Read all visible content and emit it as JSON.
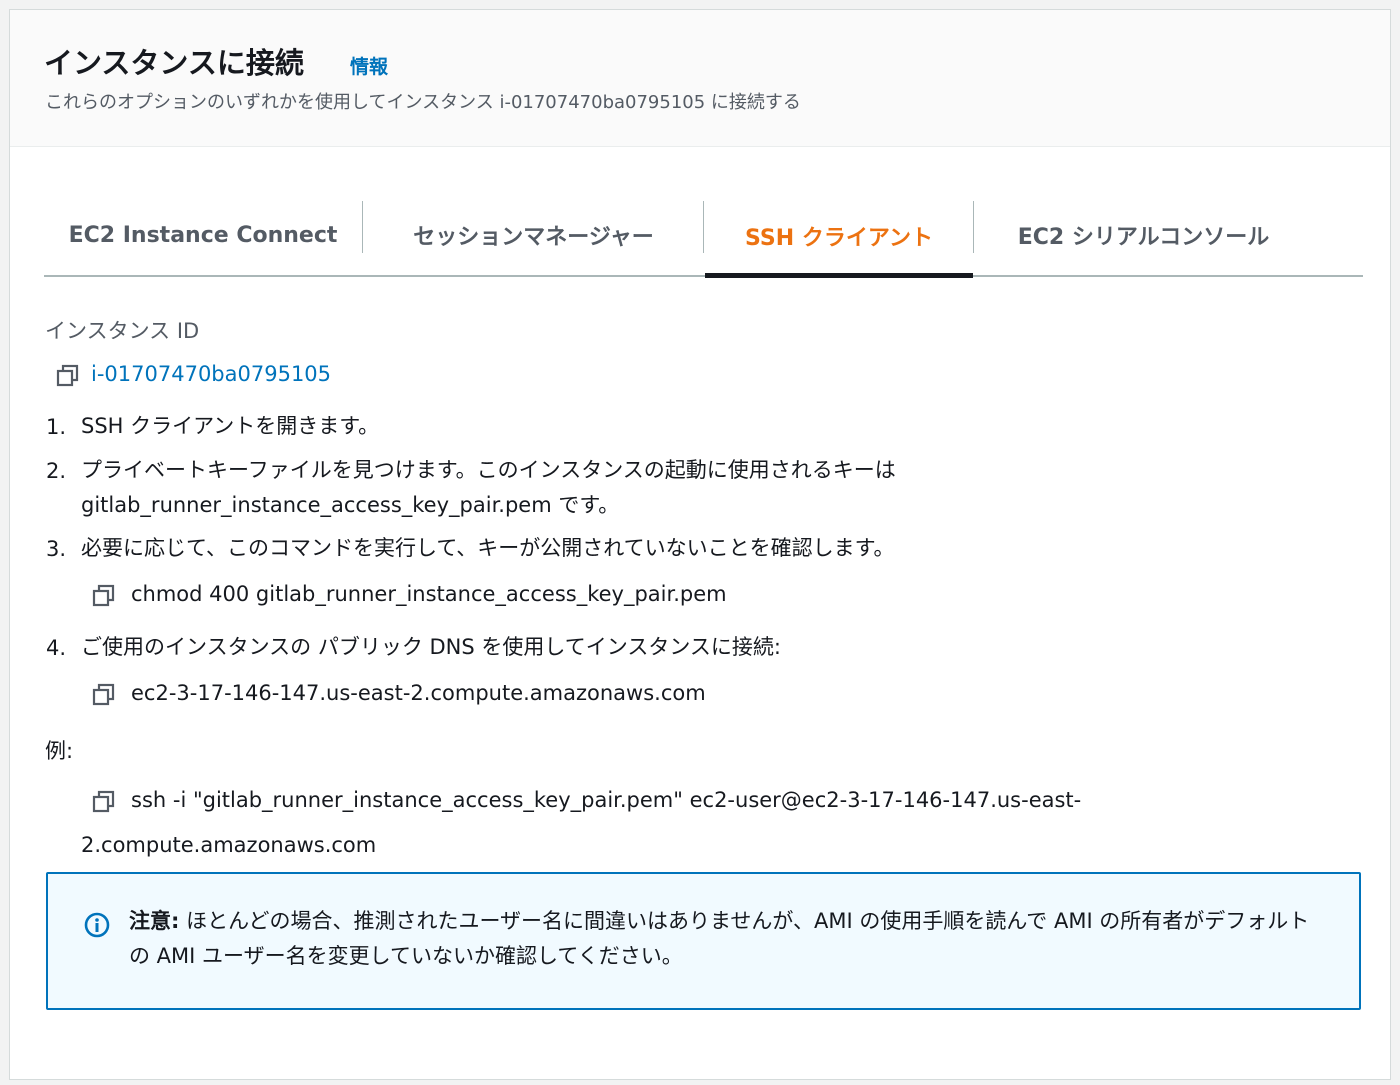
{
  "header": {
    "title": "インスタンスに接続",
    "info_link": "情報",
    "subtitle": "これらのオプションのいずれかを使用してインスタンス i-01707470ba0795105 に接続する"
  },
  "tabs": [
    {
      "label": "EC2 Instance Connect",
      "active": false
    },
    {
      "label": "セッションマネージャー",
      "active": false
    },
    {
      "label": "SSH クライアント",
      "active": true
    },
    {
      "label": "EC2 シリアルコンソール",
      "active": false
    }
  ],
  "instance": {
    "label": "インスタンス ID",
    "id": "i-01707470ba0795105"
  },
  "steps": [
    {
      "num": "1.",
      "text": "SSH クライアントを開きます。"
    },
    {
      "num": "2.",
      "line1": "プライベートキーファイルを見つけます。このインスタンスの起動に使用されるキーは",
      "line2": "gitlab_runner_instance_access_key_pair.pem です。"
    },
    {
      "num": "3.",
      "text": "必要に応じて、このコマンドを実行して、キーが公開されていないことを確認します。",
      "command": "chmod 400 gitlab_runner_instance_access_key_pair.pem"
    },
    {
      "num": "4.",
      "text": "ご使用のインスタンスの パブリック DNS を使用してインスタンスに接続:",
      "dns": "ec2-3-17-146-147.us-east-2.compute.amazonaws.com"
    }
  ],
  "example": {
    "label": "例:",
    "line1": "ssh -i \"gitlab_runner_instance_access_key_pair.pem\" ec2-user@ec2-3-17-146-147.us-east-",
    "line2": "2.compute.amazonaws.com"
  },
  "alert": {
    "strong": "注意:",
    "text": " ほとんどの場合、推測されたユーザー名に間違いはありませんが、AMI の使用手順を読んで AMI の所有者がデフォルトの AMI ユーザー名を変更していないか確認してください。"
  },
  "colors": {
    "accent_orange": "#ec7211",
    "link_blue": "#0073bb",
    "alert_bg": "#f1faff"
  }
}
